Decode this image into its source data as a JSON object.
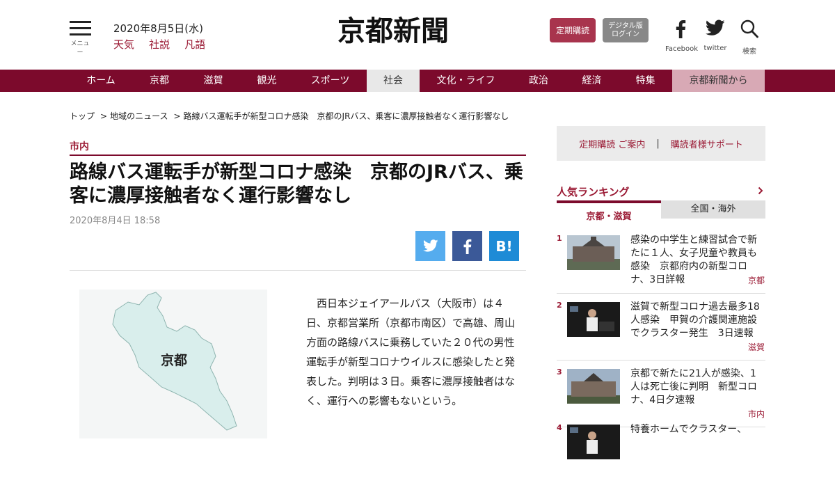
{
  "header": {
    "menu_label": "メニュー",
    "date": "2020年8月5日(水)",
    "links": [
      "天気",
      "社説",
      "凡語"
    ],
    "logo_text": "京都新聞",
    "subscribe_label": "定期購読",
    "digital_label_1": "デジタル版",
    "digital_label_2": "ログイン",
    "facebook_label": "Facebook",
    "twitter_label": "twitter",
    "search_label": "検索"
  },
  "nav": {
    "items": [
      "ホーム",
      "京都",
      "滋賀",
      "観光",
      "スポーツ",
      "社会",
      "文化・ライフ",
      "政治",
      "経済",
      "特集",
      "京都新聞から"
    ],
    "active": "社会"
  },
  "breadcrumb": [
    "トップ",
    "地域のニュース",
    "路線バス運転手が新型コロナ感染　京都のJRバス、乗客に濃厚接触者なく運行影響なし"
  ],
  "article": {
    "category": "市内",
    "headline": "路線バス運転手が新型コロナ感染　京都のJRバス、乗客に濃厚接触者なく運行影響なし",
    "date": "2020年8月4日 18:58",
    "hatena_label": "B!",
    "map_label": "京都",
    "body": "西日本ジェイアールバス（大阪市）は４日、京都営業所（京都市南区）で高雄、周山方面の路線バスに乗務していた２０代の男性運転手が新型コロナウイルスに感染したと発表した。判明は３日。乗客に濃厚接触者はなく、運行への影響もないという。"
  },
  "sidebar": {
    "subscribe_info": "定期購読 ご案内",
    "pipe": "|",
    "support": "購読者様サポート",
    "ranking_title": "人気ランキング",
    "tabs": [
      "京都・滋賀",
      "全国・海外"
    ],
    "ranking": [
      {
        "num": "1",
        "title": "感染の中学生と練習試合で新たに１人、女子児童や教員も感染　京都府内の新型コロナ、3日詳報",
        "tag": "京都"
      },
      {
        "num": "2",
        "title": "滋賀で新型コロナ過去最多18人感染　甲賀の介護関連施設でクラスター発生　3日速報",
        "tag": "滋賀"
      },
      {
        "num": "3",
        "title": "京都で新たに21人が感染、1人は死亡後に判明　新型コロナ、4日夕速報",
        "tag": "市内"
      },
      {
        "num": "4",
        "title": "特養ホームでクラスター、",
        "tag": ""
      }
    ]
  },
  "colors": {
    "brand": "#7c0a2c",
    "accent": "#9b1b35",
    "twitter": "#55acee",
    "facebook": "#3b5998",
    "hatena": "#1e8bd6"
  }
}
